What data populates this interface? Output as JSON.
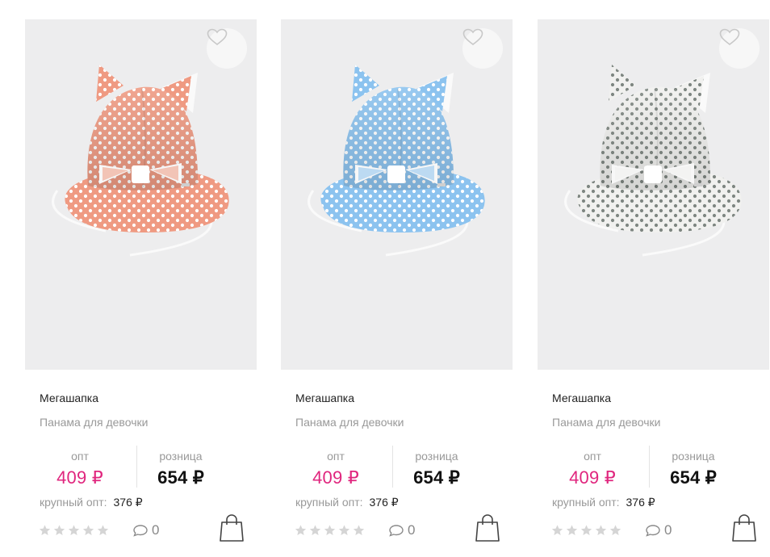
{
  "products": [
    {
      "brand": "Мегашапка",
      "title": "Панама для девочки",
      "opt_label": "опт",
      "opt_price": "409 ₽",
      "retail_label": "розница",
      "retail_price": "654 ₽",
      "bulk_label": "крупный опт:",
      "bulk_price": "376 ₽",
      "rating": 0,
      "comments": "0",
      "hat_color": "#ef9a82",
      "dot_color": "#ffffff",
      "image_icon": "hat-image"
    },
    {
      "brand": "Мегашапка",
      "title": "Панама для девочки",
      "opt_label": "опт",
      "opt_price": "409 ₽",
      "retail_label": "розница",
      "retail_price": "654 ₽",
      "bulk_label": "крупный опт:",
      "bulk_price": "376 ₽",
      "rating": 0,
      "comments": "0",
      "hat_color": "#8cc3ef",
      "dot_color": "#ffffff",
      "image_icon": "hat-image"
    },
    {
      "brand": "Мегашапка",
      "title": "Панама для девочки",
      "opt_label": "опт",
      "opt_price": "409 ₽",
      "retail_label": "розница",
      "retail_price": "654 ₽",
      "bulk_label": "крупный опт:",
      "bulk_price": "376 ₽",
      "rating": 0,
      "comments": "0",
      "hat_color": "#f1f1ef",
      "dot_color": "#7e8681",
      "image_icon": "hat-image"
    }
  ],
  "colors": {
    "accent": "#e0267e",
    "muted_text": "#999999",
    "image_bg": "#ededee"
  },
  "icons": {
    "favorite": "heart-icon",
    "comment": "comment-icon",
    "cart": "shopping-bag-icon",
    "rating": "star-icon"
  }
}
